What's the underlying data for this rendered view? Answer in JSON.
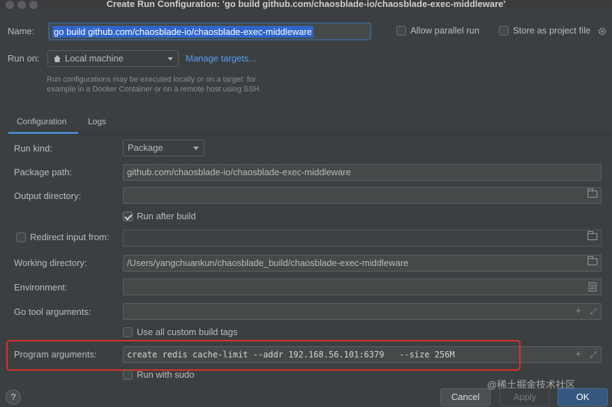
{
  "window": {
    "title": "Create Run Configuration: 'go build github.com/chaosblade-io/chaosblade-exec-middleware'"
  },
  "header": {
    "name_label": "Name:",
    "name_value": "go build github.com/chaosblade-io/chaosblade-exec-middleware",
    "allow_parallel_label": "Allow parallel run",
    "store_project_label": "Store as project file",
    "run_on_label": "Run on:",
    "run_on_value": "Local machine",
    "manage_targets": "Manage targets...",
    "hint_line1": "Run configurations may be executed locally or on a target: for",
    "hint_line2": "example in a Docker Container or on a remote host using SSH."
  },
  "tabs": [
    {
      "label": "Configuration",
      "active": true
    },
    {
      "label": "Logs",
      "active": false
    }
  ],
  "form": {
    "run_kind_label": "Run kind:",
    "run_kind_value": "Package",
    "package_path_label": "Package path:",
    "package_path_value": "github.com/chaosblade-io/chaosblade-exec-middleware",
    "output_dir_label": "Output directory:",
    "output_dir_value": "",
    "run_after_build_label": "Run after build",
    "redirect_input_label": "Redirect input from:",
    "redirect_input_value": "",
    "working_dir_label": "Working directory:",
    "working_dir_value": "/Users/yangchuankun/chaosblade_build/chaosblade-exec-middleware",
    "environment_label": "Environment:",
    "environment_value": "",
    "go_tool_args_label": "Go tool arguments:",
    "go_tool_args_value": "",
    "custom_build_tags_label": "Use all custom build tags",
    "program_args_label": "Program arguments:",
    "program_args_value": "create redis cache-limit --addr 192.168.56.101:6379   --size 256M",
    "run_with_sudo_label": "Run with sudo"
  },
  "footer": {
    "help": "?",
    "cancel": "Cancel",
    "apply": "Apply",
    "ok": "OK",
    "watermark": "@稀土掘金技术社区"
  },
  "colors": {
    "background": "#3c3f41",
    "accent": "#4a88c7",
    "highlight_box": "#e0302a",
    "ok_button": "#365880"
  }
}
